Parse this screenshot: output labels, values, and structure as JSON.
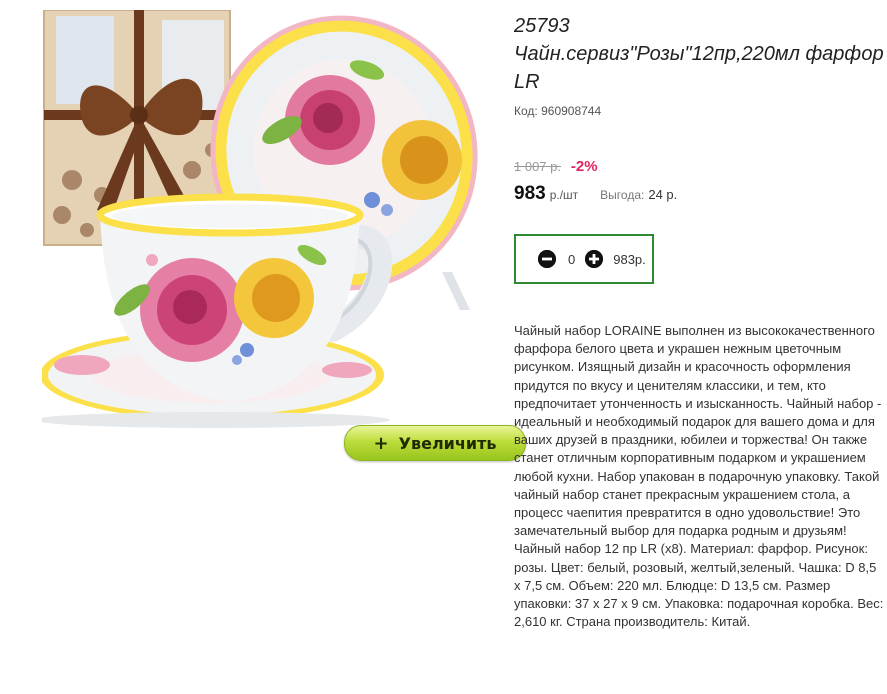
{
  "product": {
    "sku": "25793",
    "title": "Чайн.сервиз\"Розы\"12пр,220мл фарфор LR",
    "code_label": "Код:",
    "code_value": "960908744"
  },
  "pricing": {
    "old_price": "1 007 р.",
    "discount": "-2%",
    "price": "983",
    "unit": "р./шт",
    "savings_label": "Выгода:",
    "savings_value": "24 р."
  },
  "cart": {
    "minus_icon": "minus-circle-icon",
    "quantity": "0",
    "plus_icon": "plus-circle-icon",
    "total": "983р."
  },
  "image": {
    "zoom_label": "Увеличить",
    "zoom_icon": "plus"
  },
  "description": "Чайный набор LORAINE выполнен из высококачественного фарфора белого цвета и украшен нежным цветочным рисунком. Изящный дизайн и красочность оформления придутся по вкусу и ценителям классики, и тем, кто предпочитает утонченность и изысканность. Чайный набор - идеальный и необходимый подарок для вашего дома и для ваших друзей в праздники, юбилеи и торжества! Он также станет отличным корпоративным подарком и украшением любой кухни. Набор упакован в подарочную упаковку. Такой чайный набор станет прекрасным украшением стола, а процесс чаепития превратится в одно удовольствие! Это замечательный выбор для подарка родным и друзьям! Чайный набор 12 пр LR (x8). Материал: фарфор. Рисунок: розы. Цвет: белый, розовый, желтый,зеленый. Чашка: D 8,5 х 7,5 см. Объем: 220 мл. Блюдце: D 13,5 см. Размер упаковки: 37 х 27 х 9 см. Упаковка: подарочная коробка. Вес: 2,610 кг. Страна производитель: Китай.",
  "colors": {
    "accent_green": "#2e8a2e",
    "discount_red": "#e0245e",
    "button_green": "#a6cf2a"
  }
}
